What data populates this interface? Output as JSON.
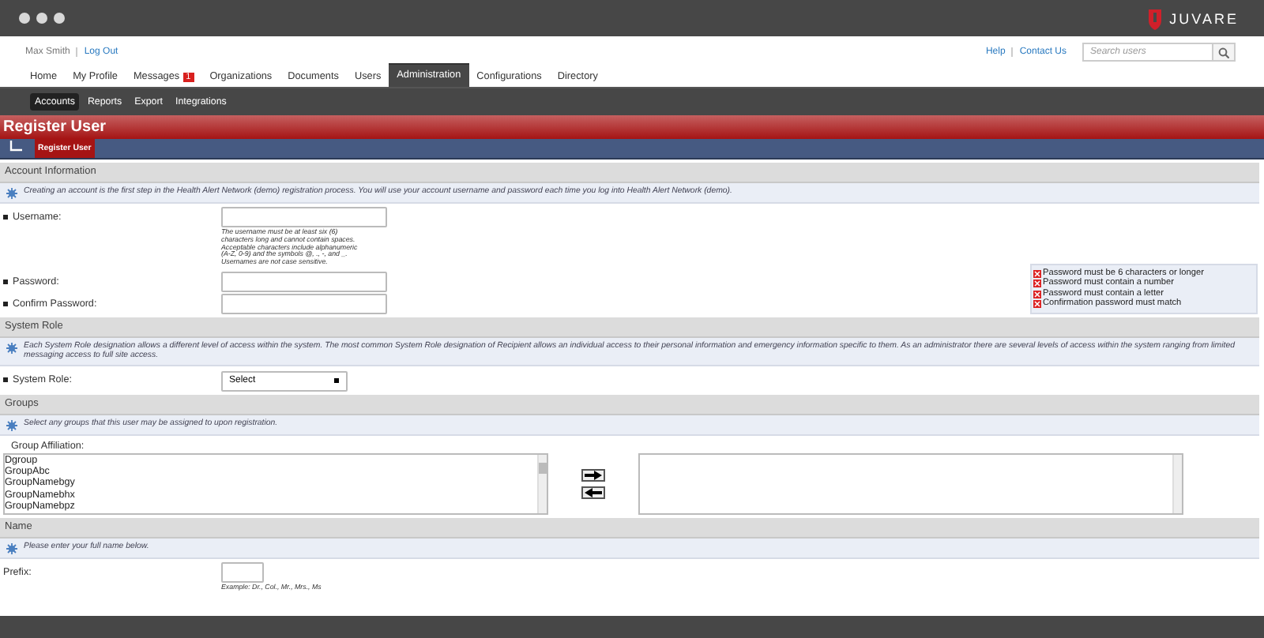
{
  "brand": {
    "name": "JUVARE"
  },
  "user_links": [
    {
      "label": "Max Smith",
      "kind": "text"
    },
    {
      "label": "Log Out",
      "kind": "link"
    }
  ],
  "help_links": [
    "Help",
    "Contact Us"
  ],
  "search": {
    "placeholder": "Search users"
  },
  "nav_tabs": [
    {
      "label": "Home",
      "selected": false
    },
    {
      "label": "My Profile",
      "selected": false
    },
    {
      "label": "Messages",
      "selected": false,
      "badge": "1"
    },
    {
      "label": "Organizations",
      "selected": false
    },
    {
      "label": "Documents",
      "selected": false
    },
    {
      "label": "Users",
      "selected": false
    },
    {
      "label": "Administration",
      "selected": true
    },
    {
      "label": "Configurations",
      "selected": false
    },
    {
      "label": "Directory",
      "selected": false
    }
  ],
  "sub_tabs": [
    {
      "label": "Accounts",
      "selected": true
    },
    {
      "label": "Reports",
      "selected": false
    },
    {
      "label": "Export",
      "selected": false
    },
    {
      "label": "Integrations",
      "selected": false
    }
  ],
  "page_title": "Register User",
  "breadcrumb": {
    "label": "Register User"
  },
  "sections": [
    {
      "title": "Account Information",
      "info": "Creating an account is the first step in the Health Alert Network (demo) registration process. You will use your account username and password each time you log into Health Alert Network (demo).",
      "fields": [
        {
          "kind": "text",
          "label": "Username:",
          "required": true,
          "hint": "The username must be at least six (6) characters long and cannot contain spaces. Acceptable characters include alphanumeric (A-Z, 0-9) and the symbols @, ., -, and _. Usernames are not case sensitive."
        },
        {
          "kind": "password",
          "label": "Password:",
          "required": true
        },
        {
          "kind": "password",
          "label": "Confirm Password:",
          "required": true
        }
      ],
      "rules": [
        {
          "text": "Password must be 6 characters or longer",
          "passed": false
        },
        {
          "text": "Password must contain a number",
          "passed": false
        },
        {
          "text": "Password must contain a letter",
          "passed": false
        },
        {
          "text": "Confirmation password must match",
          "passed": false
        }
      ]
    },
    {
      "title": "System Role",
      "info": "Each System Role designation allows a different level of access within the system. The most common System Role designation of Recipient allows an individual access to their personal information and emergency information specific to them. As an administrator there are several levels of access within the system ranging from limited messaging access to full site access.",
      "fields": [
        {
          "kind": "select",
          "label": "System Role:",
          "required": true,
          "value": "Select"
        }
      ]
    },
    {
      "title": "Groups",
      "info": "Select any groups that this user may be assigned to upon registration.",
      "fields": [
        {
          "kind": "dual_list",
          "label": "Group Affiliation:",
          "required": false,
          "options": [
            "Dgroup",
            "GroupAbc",
            "GroupNamebgy",
            "GroupNamebhx",
            "GroupNamebpz"
          ]
        }
      ]
    },
    {
      "title": "Name",
      "info": "Please enter your full name below.",
      "fields": [
        {
          "kind": "short_text",
          "label": "Prefix:",
          "required": false,
          "hint": "Example: Dr., Col., Mr., Mrs., Ms"
        }
      ]
    }
  ]
}
